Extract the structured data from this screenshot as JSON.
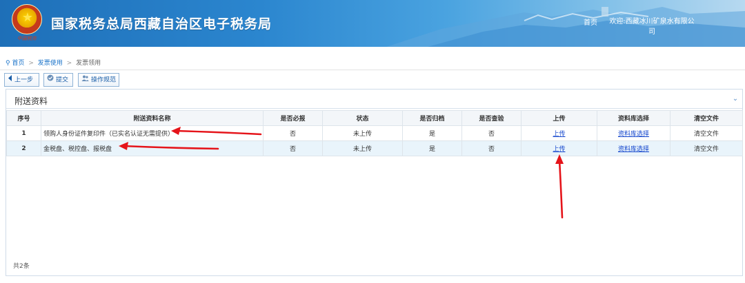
{
  "header": {
    "emblem_text": "中国税务",
    "title": "国家税务总局西藏自治区电子税务局",
    "home_link": "首页",
    "welcome_text": "欢迎:西藏冰川矿泉水有限公司"
  },
  "breadcrumb": {
    "items": [
      "首页",
      "发票使用",
      "发票领用"
    ],
    "separator": ">"
  },
  "toolbar": {
    "prev_label": "上一步",
    "submit_label": "提交",
    "guide_label": "操作规范"
  },
  "panel": {
    "title": "附送资料",
    "columns": [
      "序号",
      "附送资料名称",
      "是否必报",
      "状态",
      "是否归档",
      "是否查验",
      "上传",
      "资料库选择",
      "清空文件"
    ],
    "rows": [
      {
        "index": "1",
        "name": "领购人身份证件复印件（已实名认证无需提供）",
        "required": "否",
        "status": "未上传",
        "archived": "是",
        "verified": "否",
        "upload": "上传",
        "library": "资料库选择",
        "clear": "清空文件"
      },
      {
        "index": "2",
        "name": "金税盘、税控盘、报税盘",
        "required": "否",
        "status": "未上传",
        "archived": "是",
        "verified": "否",
        "upload": "上传",
        "library": "资料库选择",
        "clear": "清空文件"
      }
    ],
    "footer_count": "共2条"
  },
  "colors": {
    "header_blue": "#2b86cf",
    "link_blue": "#1144cc",
    "annotation_red": "#e5141a",
    "selected_row": "#e9f4fb"
  }
}
